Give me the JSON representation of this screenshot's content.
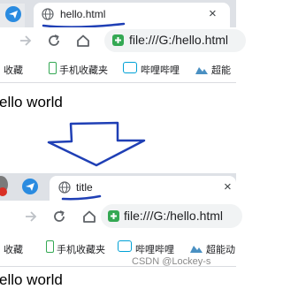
{
  "top_window": {
    "tab_title": "hello.html",
    "close_glyph": "×",
    "url": "file:///G:/hello.html",
    "bookmarks": [
      "收藏",
      "手机收藏夹",
      "哔哩哔哩",
      "超能"
    ],
    "page_text": "ello world"
  },
  "bottom_window": {
    "tab_title": "title",
    "close_glyph": "×",
    "url": "file:///G:/hello.html",
    "bookmarks": [
      "收藏",
      "手机收藏夹",
      "哔哩哔哩",
      "超能动"
    ],
    "page_text": "ello world"
  },
  "watermark": "CSDN @Lockey-s",
  "colors": {
    "annotation": "#1f3fb5",
    "tab_strip": "#dee1e6",
    "omnibox": "#f1f3f4",
    "secure_icon": "#34a853"
  }
}
